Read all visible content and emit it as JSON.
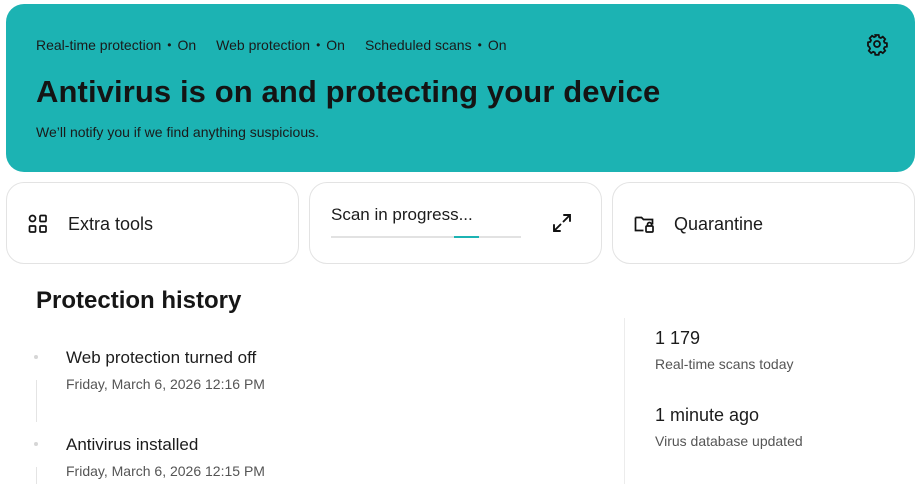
{
  "banner": {
    "status_items": [
      {
        "label": "Real-time protection",
        "state": "On"
      },
      {
        "label": "Web protection",
        "state": "On"
      },
      {
        "label": "Scheduled scans",
        "state": "On"
      }
    ],
    "separator": "•",
    "headline": "Antivirus is on and protecting your device",
    "subline": "We’ll notify you if we find anything suspicious.",
    "settings_icon": "gear-icon",
    "background_color": "#1cb3b3"
  },
  "cards": {
    "extra_tools": {
      "label": "Extra tools",
      "icon": "apps-grid-icon"
    },
    "scan": {
      "label": "Scan in progress...",
      "progress": 0.78,
      "icon": "expand-icon"
    },
    "quarantine": {
      "label": "Quarantine",
      "icon": "folder-lock-icon"
    }
  },
  "history": {
    "title": "Protection history",
    "events": [
      {
        "title": "Web protection turned off",
        "date": "Friday, March 6, 2026 12:16 PM"
      },
      {
        "title": "Antivirus installed",
        "date": "Friday, March 6, 2026 12:15 PM"
      }
    ]
  },
  "stats": [
    {
      "value": "1 179",
      "label": "Real-time scans today"
    },
    {
      "value": "1 minute ago",
      "label": "Virus database updated"
    }
  ]
}
